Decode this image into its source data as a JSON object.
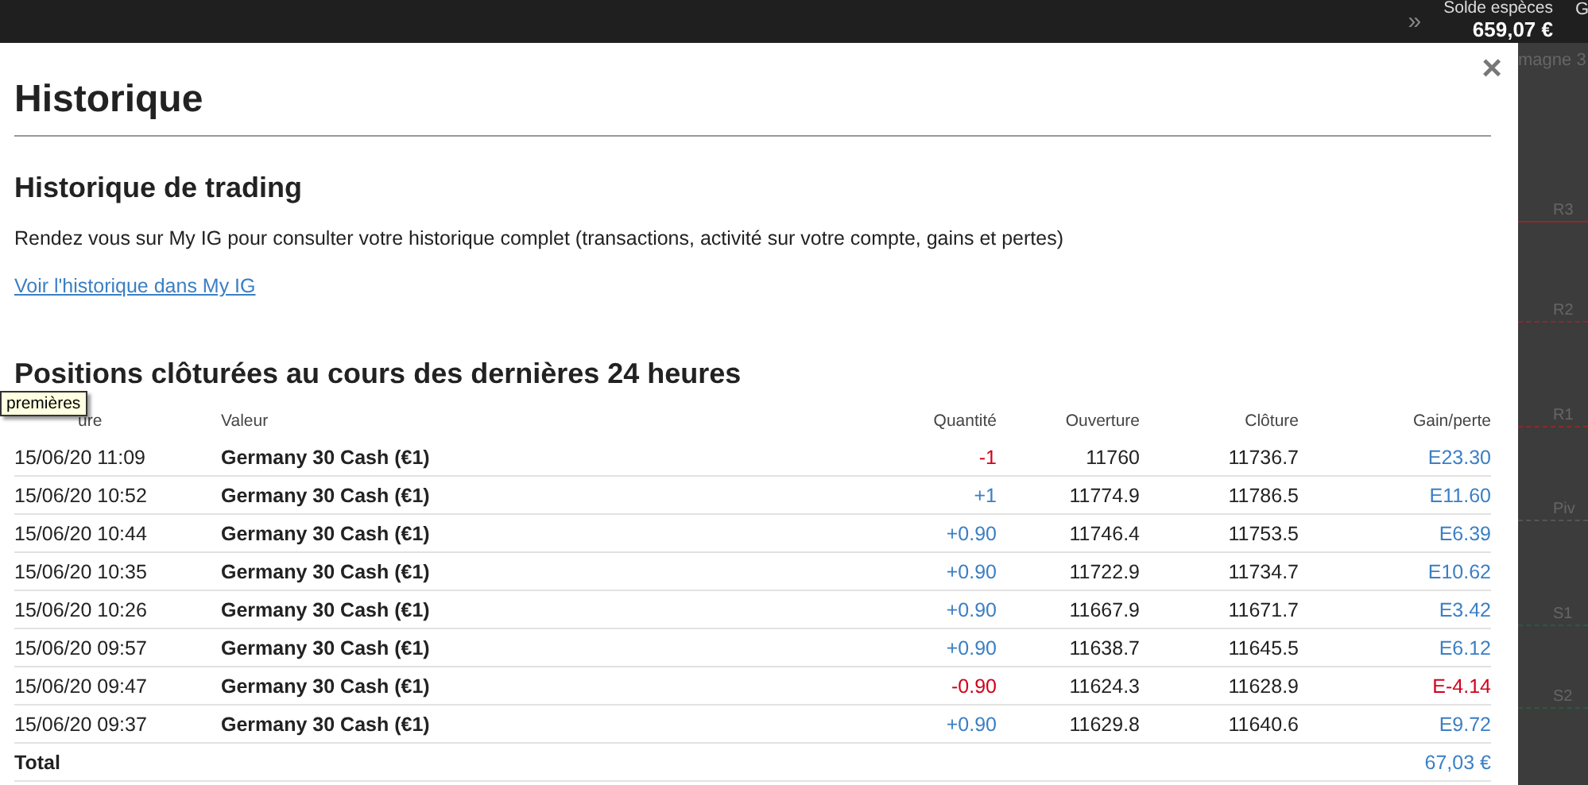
{
  "top_bar": {
    "expand": "»",
    "cash_label": "Solde espèces",
    "cash_value": "659,07 €",
    "cut_label": "G"
  },
  "background_chart": {
    "title": "magne 3",
    "levels": [
      {
        "label": "R3",
        "kind": "solid",
        "color": "#8a2a2a"
      },
      {
        "label": "R2",
        "kind": "dashed",
        "color": "#8a2a2a"
      },
      {
        "label": "R1",
        "kind": "dashed",
        "color": "#8a2a2a"
      },
      {
        "label": "Piv",
        "kind": "dashed",
        "color": "#555555"
      },
      {
        "label": "S1",
        "kind": "dashed",
        "color": "#2a5a3a"
      },
      {
        "label": "S2",
        "kind": "dashed",
        "color": "#2a5a3a"
      }
    ]
  },
  "dialog": {
    "title": "Historique",
    "close": "×",
    "trading": {
      "heading": "Historique de trading",
      "text": "Rendez vous sur My IG pour consulter votre historique complet (transactions, activité sur votre compte, gains et pertes)",
      "link": "Voir l'historique dans My IG"
    },
    "positions": {
      "heading": "Positions clôturées au cours des dernières 24 heures",
      "tooltip": "premières",
      "columns": [
        "ure",
        "Valeur",
        "Quantité",
        "Ouverture",
        "Clôture",
        "Gain/perte"
      ],
      "rows": [
        {
          "date": "15/06/20 11:09",
          "value": "Germany 30 Cash (€1)",
          "quantity": {
            "text": "-1",
            "color": "#d0021b"
          },
          "open": "11760",
          "close": "11736.7",
          "gain": {
            "text": "E23.30",
            "color": "#3b7fc4"
          }
        },
        {
          "date": "15/06/20 10:52",
          "value": "Germany 30 Cash (€1)",
          "quantity": {
            "text": "+1",
            "color": "#3b7fc4"
          },
          "open": "11774.9",
          "close": "11786.5",
          "gain": {
            "text": "E11.60",
            "color": "#3b7fc4"
          }
        },
        {
          "date": "15/06/20 10:44",
          "value": "Germany 30 Cash (€1)",
          "quantity": {
            "text": "+0.90",
            "color": "#3b7fc4"
          },
          "open": "11746.4",
          "close": "11753.5",
          "gain": {
            "text": "E6.39",
            "color": "#3b7fc4"
          }
        },
        {
          "date": "15/06/20 10:35",
          "value": "Germany 30 Cash (€1)",
          "quantity": {
            "text": "+0.90",
            "color": "#3b7fc4"
          },
          "open": "11722.9",
          "close": "11734.7",
          "gain": {
            "text": "E10.62",
            "color": "#3b7fc4"
          }
        },
        {
          "date": "15/06/20 10:26",
          "value": "Germany 30 Cash (€1)",
          "quantity": {
            "text": "+0.90",
            "color": "#3b7fc4"
          },
          "open": "11667.9",
          "close": "11671.7",
          "gain": {
            "text": "E3.42",
            "color": "#3b7fc4"
          }
        },
        {
          "date": "15/06/20 09:57",
          "value": "Germany 30 Cash (€1)",
          "quantity": {
            "text": "+0.90",
            "color": "#3b7fc4"
          },
          "open": "11638.7",
          "close": "11645.5",
          "gain": {
            "text": "E6.12",
            "color": "#3b7fc4"
          }
        },
        {
          "date": "15/06/20 09:47",
          "value": "Germany 30 Cash (€1)",
          "quantity": {
            "text": "-0.90",
            "color": "#d0021b"
          },
          "open": "11624.3",
          "close": "11628.9",
          "gain": {
            "text": "E-4.14",
            "color": "#d0021b"
          }
        },
        {
          "date": "15/06/20 09:37",
          "value": "Germany 30 Cash (€1)",
          "quantity": {
            "text": "+0.90",
            "color": "#3b7fc4"
          },
          "open": "11629.8",
          "close": "11640.6",
          "gain": {
            "text": "E9.72",
            "color": "#3b7fc4"
          }
        }
      ],
      "total": {
        "label": "Total",
        "value": "67,03 €"
      }
    }
  }
}
